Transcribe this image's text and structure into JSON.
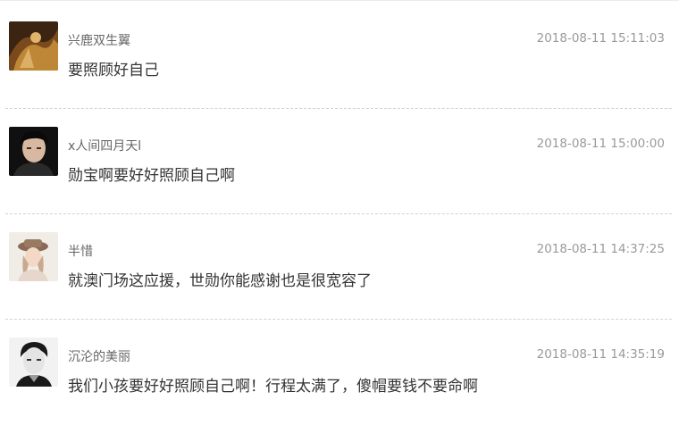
{
  "comments": [
    {
      "username": "兴鹿双生翼",
      "timestamp": "2018-08-11 15:11:03",
      "text": "要照顾好自己",
      "avatar_icon": "avatar-photo-golden-figure",
      "avatar_colors": [
        "#3b2412",
        "#c9923c",
        "#7a4a1c"
      ]
    },
    {
      "username": "x人间四月天l",
      "timestamp": "2018-08-11 15:00:00",
      "text": "勋宝啊要好好照顾自己啊",
      "avatar_icon": "avatar-photo-dark-portrait",
      "avatar_colors": [
        "#101010",
        "#2a2a2a",
        "#d8b8a0"
      ]
    },
    {
      "username": "半惜",
      "timestamp": "2018-08-11 14:37:25",
      "text": "就澳门场这应援，世勋你能感谢也是很宽容了",
      "avatar_icon": "avatar-photo-girl-with-hat",
      "avatar_colors": [
        "#f0ece6",
        "#c9a890",
        "#8a6a55"
      ]
    },
    {
      "username": "沉沦的美丽",
      "timestamp": "2018-08-11 14:35:19",
      "text": "我们小孩要好好照顾自己啊！行程太满了，傻帽要钱不要命啊",
      "avatar_icon": "avatar-photo-bw-portrait",
      "avatar_colors": [
        "#f2f2f2",
        "#1a1a1a",
        "#9c9c9c"
      ]
    }
  ]
}
